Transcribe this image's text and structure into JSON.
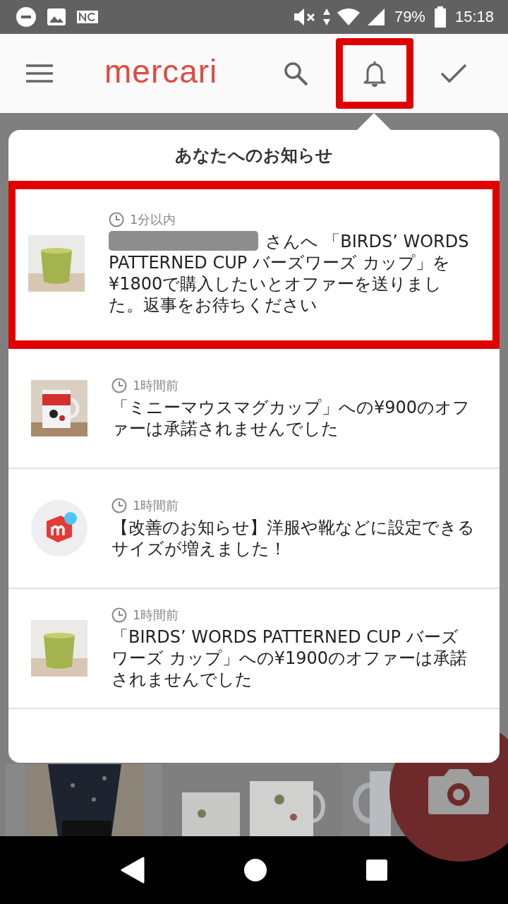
{
  "status_bar": {
    "battery": "79%",
    "time": "15:18"
  },
  "app_bar": {
    "logo": "mercari",
    "actions": [
      {
        "kind": "search",
        "highlighted": false
      },
      {
        "kind": "bell",
        "highlighted": true
      },
      {
        "kind": "check",
        "highlighted": false
      }
    ]
  },
  "notifications": {
    "title": "あなたへのお知らせ",
    "items": [
      {
        "kind": "picture",
        "time": "1分以内",
        "redacted_sender": true,
        "message": "さんへ 「BIRDS’ WORDS PATTERNED CUP バーズワーズ カップ」を¥1800で購入したいとオファーを送りました。返事をお待ちください",
        "highlighted": true
      },
      {
        "kind": "picture",
        "time": "1時間前",
        "redacted_sender": false,
        "message": "「ミニーマウスマグカップ」への¥900のオファーは承諾されませんでした",
        "highlighted": false
      },
      {
        "kind": "logo",
        "time": "1時間前",
        "redacted_sender": false,
        "message": "【改善のお知らせ】洋服や靴などに設定できるサイズが増えました！",
        "highlighted": false
      },
      {
        "kind": "picture",
        "time": "1時間前",
        "redacted_sender": false,
        "message": "「BIRDS’ WORDS PATTERNED CUP バーズワーズ カップ」への¥1900のオファーは承諾されませんでした",
        "highlighted": false
      }
    ]
  }
}
